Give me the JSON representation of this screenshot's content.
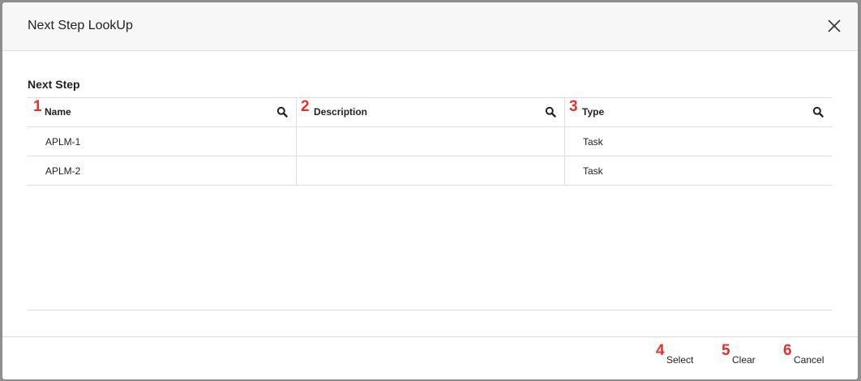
{
  "dialog": {
    "title": "Next Step LookUp",
    "close_icon": "close-icon"
  },
  "section": {
    "label": "Next Step"
  },
  "table": {
    "columns": [
      {
        "marker": "1",
        "label": "Name",
        "icon": "search-icon"
      },
      {
        "marker": "2",
        "label": "Description",
        "icon": "search-icon"
      },
      {
        "marker": "3",
        "label": "Type",
        "icon": "search-icon"
      }
    ],
    "rows": [
      {
        "name": "APLM-1",
        "description": "",
        "type": "Task"
      },
      {
        "name": "APLM-2",
        "description": "",
        "type": "Task"
      }
    ]
  },
  "footer": {
    "buttons": [
      {
        "marker": "4",
        "label": "Select"
      },
      {
        "marker": "5",
        "label": "Clear"
      },
      {
        "marker": "6",
        "label": "Cancel"
      }
    ]
  },
  "colors": {
    "marker": "#e5322d",
    "backdrop": "#8e8e8e",
    "header_bg": "#f7f7f7"
  }
}
